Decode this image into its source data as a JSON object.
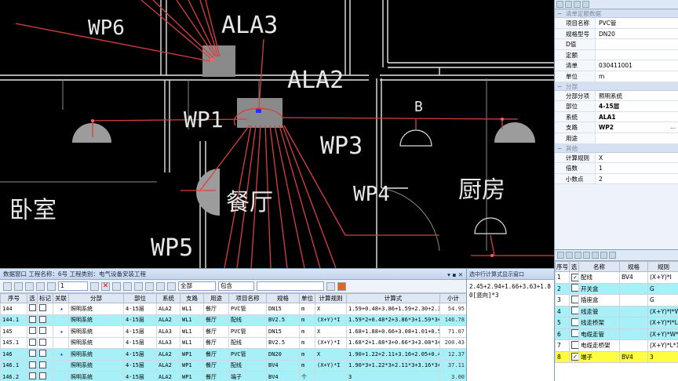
{
  "cad": {
    "labels": {
      "wp6": "WP6",
      "ala3": "ALA3",
      "ala2": "ALA2",
      "wp1": "WP1",
      "wp3": "WP3",
      "wp4": "WP4",
      "wp5": "WP5",
      "b": "B",
      "bedroom": "卧室",
      "dining": "餐厅",
      "kitchen": "厨房"
    }
  },
  "props": {
    "sections": {
      "list": "清单定额数据",
      "part": "分部",
      "rule": "其他"
    },
    "rows": [
      {
        "k": "项目名称",
        "v": "PVC管"
      },
      {
        "k": "规格型号",
        "v": "DN20"
      },
      {
        "k": "D值",
        "v": ""
      },
      {
        "k": "定额",
        "v": ""
      },
      {
        "k": "清单",
        "v": "030411001"
      },
      {
        "k": "单位",
        "v": "m"
      }
    ],
    "rows2": [
      {
        "k": "分部分项",
        "v": "照明系统"
      },
      {
        "k": "部位",
        "v": "4-15层"
      },
      {
        "k": "系统",
        "v": "ALA1"
      },
      {
        "k": "支路",
        "v": "WP2"
      },
      {
        "k": "用途",
        "v": ""
      }
    ],
    "rows3": [
      {
        "k": "计算规则",
        "v": "X"
      },
      {
        "k": "倍数",
        "v": "1"
      },
      {
        "k": "小数点",
        "v": "2"
      }
    ],
    "more": "..."
  },
  "datawin": {
    "title": "数据窗口  工程名称：6号  工程类别：电气设备安装工程",
    "page_value": "1",
    "scope": "全部",
    "match": "包含",
    "columns": [
      "序号",
      "选",
      "标记",
      "关联",
      "分部",
      "部位",
      "系统",
      "支路",
      "用途",
      "项目名称",
      "规格",
      "单位",
      "计算规则",
      "计算式",
      "小计"
    ],
    "rows": [
      {
        "id": "144",
        "star": true,
        "part": "照明系统",
        "loc": "4-15层",
        "sys": "ALA2",
        "branch": "WL1",
        "use": "餐厅",
        "name": "PVC管",
        "spec": "DN15",
        "unit": "m",
        "rule": "X",
        "formula": "1.59+0.48+3.86+1.59+2.30+2.3",
        "sub": "54.95",
        "style": "wh"
      },
      {
        "id": "144.1",
        "star": false,
        "part": "照明系统",
        "loc": "4-15层",
        "sys": "ALA2",
        "branch": "WL1",
        "use": "餐厅",
        "name": "配线",
        "spec": "BV2.5",
        "unit": "m",
        "rule": "(X+Y)*I",
        "formula": "1.59*2+0.48*2+3.86*3+1.59*3+",
        "sub": "146.78",
        "style": "cy"
      },
      {
        "id": "145",
        "star": true,
        "part": "照明系统",
        "loc": "4-15层",
        "sys": "ALA3",
        "branch": "WL1",
        "use": "餐厅",
        "name": "PVC管",
        "spec": "DN15",
        "unit": "m",
        "rule": "X",
        "formula": "1.68+1.88+0.66+3.08+1.01+0.5",
        "sub": "71.07",
        "style": "wh"
      },
      {
        "id": "145.1",
        "star": false,
        "part": "照明系统",
        "loc": "4-15层",
        "sys": "ALA3",
        "branch": "WL1",
        "use": "餐厅",
        "name": "配线",
        "spec": "BV2.5",
        "unit": "m",
        "rule": "(X+Y)*I",
        "formula": "1.68*2+1.88*3+0.66*3+3.08*3+",
        "sub": "200.43",
        "style": "wh"
      },
      {
        "id": "146",
        "star": true,
        "part": "照明系统",
        "loc": "4-15层",
        "sys": "ALA2",
        "branch": "WP1",
        "use": "餐厅",
        "name": "PVC管",
        "spec": "DN20",
        "unit": "m",
        "rule": "X",
        "formula": "1.90+1.22+2.11+3.16+2.05+0.4",
        "sub": "12.37",
        "style": "cy"
      },
      {
        "id": "146.1",
        "star": false,
        "part": "照明系统",
        "loc": "4-15层",
        "sys": "ALA2",
        "branch": "WP1",
        "use": "餐厅",
        "name": "配线",
        "spec": "BV4",
        "unit": "m",
        "rule": "(X+Y)*I",
        "formula": "1.90*3+1.22*3+2.11*3+3.16*3+",
        "sub": "37.11",
        "style": "cy"
      },
      {
        "id": "146.2",
        "star": false,
        "part": "照明系统",
        "loc": "4-15层",
        "sys": "ALA2",
        "branch": "WP1",
        "use": "餐厅",
        "name": "端子",
        "spec": "BV4",
        "unit": "个",
        "rule": "",
        "formula": "3",
        "sub": "3.00",
        "style": "cy"
      }
    ]
  },
  "formula": {
    "title": "选中行计算式显示窗口",
    "text": "2.45+2.94+1.66+3.63+1.80[竖向]*3"
  },
  "subitems": {
    "columns": [
      "序号",
      "选",
      "名称",
      "规格",
      "规则"
    ],
    "rows": [
      {
        "id": "1",
        "checked": true,
        "name": "配线",
        "spec": "BV4",
        "rule": "(X+Y)*I",
        "style": "wh"
      },
      {
        "id": "2",
        "checked": false,
        "name": "开关盒",
        "spec": "",
        "rule": "G",
        "style": "cy"
      },
      {
        "id": "3",
        "checked": false,
        "name": "插座盒",
        "spec": "",
        "rule": "G",
        "style": "wh"
      },
      {
        "id": "4",
        "checked": false,
        "name": "线走管",
        "spec": "",
        "rule": "(X+Y)*I*W",
        "style": "cy"
      },
      {
        "id": "5",
        "checked": false,
        "name": "线走桥架",
        "spec": "",
        "rule": "(X+Y)*I*L",
        "style": "cy"
      },
      {
        "id": "6",
        "checked": false,
        "name": "电缆走管",
        "spec": "",
        "rule": "(X+Y)*W*1.0",
        "style": "cy"
      },
      {
        "id": "7",
        "checked": false,
        "name": "电缆走桥架",
        "spec": "",
        "rule": "(X+Y)*L*1.0",
        "style": "wh"
      },
      {
        "id": "8",
        "checked": true,
        "name": "端子",
        "spec": "BV4",
        "rule": "3",
        "style": "ye"
      }
    ]
  },
  "colors": {
    "cyan_row": "#a8f0f8",
    "highlight": "#ffff40",
    "wire": "#d84040",
    "wall": "#e8e8e8"
  }
}
